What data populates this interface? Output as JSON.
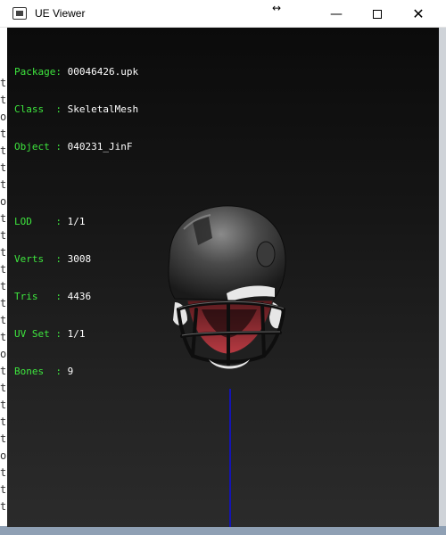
{
  "window": {
    "title": "UE Viewer",
    "resize_hint": "↔"
  },
  "title_buttons": {
    "minimize": "—",
    "close": "✕"
  },
  "info": {
    "package": {
      "label": "Package",
      "value": "00046426.upk"
    },
    "class": {
      "label": "Class  ",
      "value": "SkeletalMesh"
    },
    "object": {
      "label": "Object ",
      "value": "040231_JinF"
    },
    "lod": {
      "label": "LOD    ",
      "value": "1/1"
    },
    "verts": {
      "label": "Verts  ",
      "value": "3008"
    },
    "tris": {
      "label": "Tris   ",
      "value": "4436"
    },
    "uvset": {
      "label": "UV Set ",
      "value": "1/1"
    },
    "bones": {
      "label": "Bones  ",
      "value": "9"
    }
  },
  "separator": ": ",
  "background_glyphs": [
    "t",
    "t",
    "o",
    "t",
    "t",
    "t",
    "t",
    "o",
    "t",
    "t",
    "t",
    "t",
    "t",
    "t",
    "t",
    "t",
    "o",
    "t",
    "t",
    "t",
    "t",
    "t",
    "o",
    "t",
    "t",
    "t"
  ],
  "colors": {
    "label": "#3ee63e",
    "value": "#ffffff",
    "axis": "#1414b4",
    "viewport_top": "#0b0b0b",
    "viewport_bottom": "#2b2b2b"
  },
  "model": {
    "icon": "helmet-icon"
  }
}
